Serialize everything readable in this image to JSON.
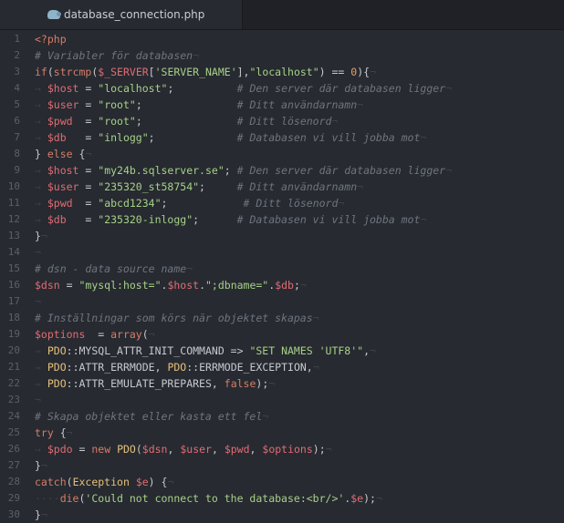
{
  "tab": {
    "filename": "database_connection.php",
    "icon": "php-elephant-icon"
  },
  "colors": {
    "background": "#272a30",
    "keyword": "#e5c07b",
    "variable": "#e06c75",
    "string": "#a6d189",
    "comment": "#6e7580",
    "number": "#e5a06b"
  },
  "lines": [
    {
      "n": "1",
      "tokens": [
        [
          "t-kw2",
          "<?php"
        ]
      ]
    },
    {
      "n": "2",
      "tokens": [
        [
          "t-cmt",
          "# Variabler för databasen"
        ],
        [
          "t-ws",
          "¬"
        ]
      ]
    },
    {
      "n": "3",
      "tokens": [
        [
          "t-fn",
          "if"
        ],
        [
          "t-pun",
          "("
        ],
        [
          "t-fn",
          "strcmp"
        ],
        [
          "t-pun",
          "("
        ],
        [
          "t-var",
          "$_SERVER"
        ],
        [
          "t-pun",
          "["
        ],
        [
          "t-str",
          "'SERVER_NAME'"
        ],
        [
          "t-pun",
          "],"
        ],
        [
          "t-str",
          "\"localhost\""
        ],
        [
          "t-pun",
          ") == "
        ],
        [
          "t-num",
          "0"
        ],
        [
          "t-pun",
          "){"
        ],
        [
          "t-ws",
          "¬"
        ]
      ]
    },
    {
      "n": "4",
      "tokens": [
        [
          "t-ws",
          "→ "
        ],
        [
          "t-var",
          "$host"
        ],
        [
          "t-op",
          " = "
        ],
        [
          "t-str",
          "\"localhost\""
        ],
        [
          "t-pun",
          ";          "
        ],
        [
          "t-cmt",
          "# Den server där databasen ligger"
        ],
        [
          "t-ws",
          "¬"
        ]
      ]
    },
    {
      "n": "5",
      "tokens": [
        [
          "t-ws",
          "→ "
        ],
        [
          "t-var",
          "$user"
        ],
        [
          "t-op",
          " = "
        ],
        [
          "t-str",
          "\"root\""
        ],
        [
          "t-pun",
          ";               "
        ],
        [
          "t-cmt",
          "# Ditt användarnamn"
        ],
        [
          "t-ws",
          "¬"
        ]
      ]
    },
    {
      "n": "6",
      "tokens": [
        [
          "t-ws",
          "→ "
        ],
        [
          "t-var",
          "$pwd"
        ],
        [
          "t-op",
          "  = "
        ],
        [
          "t-str",
          "\"root\""
        ],
        [
          "t-pun",
          ";               "
        ],
        [
          "t-cmt",
          "# Ditt lösenord"
        ],
        [
          "t-ws",
          "¬"
        ]
      ]
    },
    {
      "n": "7",
      "tokens": [
        [
          "t-ws",
          "→ "
        ],
        [
          "t-var",
          "$db"
        ],
        [
          "t-op",
          "   = "
        ],
        [
          "t-str",
          "\"inlogg\""
        ],
        [
          "t-pun",
          ";             "
        ],
        [
          "t-cmt",
          "# Databasen vi vill jobba mot"
        ],
        [
          "t-ws",
          "¬"
        ]
      ]
    },
    {
      "n": "8",
      "tokens": [
        [
          "t-pun",
          "} "
        ],
        [
          "t-fn",
          "else"
        ],
        [
          "t-pun",
          " {"
        ],
        [
          "t-ws",
          "¬"
        ]
      ]
    },
    {
      "n": "9",
      "tokens": [
        [
          "t-ws",
          "→ "
        ],
        [
          "t-var",
          "$host"
        ],
        [
          "t-op",
          " = "
        ],
        [
          "t-str",
          "\"my24b.sqlserver.se\""
        ],
        [
          "t-pun",
          "; "
        ],
        [
          "t-cmt",
          "# Den server där databasen ligger"
        ],
        [
          "t-ws",
          "¬"
        ]
      ]
    },
    {
      "n": "10",
      "tokens": [
        [
          "t-ws",
          "→ "
        ],
        [
          "t-var",
          "$user"
        ],
        [
          "t-op",
          " = "
        ],
        [
          "t-str",
          "\"235320_st58754\""
        ],
        [
          "t-pun",
          ";     "
        ],
        [
          "t-cmt",
          "# Ditt användarnamn"
        ],
        [
          "t-ws",
          "¬"
        ]
      ]
    },
    {
      "n": "11",
      "tokens": [
        [
          "t-ws",
          "→ "
        ],
        [
          "t-var",
          "$pwd"
        ],
        [
          "t-op",
          "  = "
        ],
        [
          "t-str",
          "\"abcd1234\""
        ],
        [
          "t-pun",
          ";            "
        ],
        [
          "t-cmt",
          "# Ditt lösenord"
        ],
        [
          "t-ws",
          "¬"
        ]
      ]
    },
    {
      "n": "12",
      "tokens": [
        [
          "t-ws",
          "→ "
        ],
        [
          "t-var",
          "$db"
        ],
        [
          "t-op",
          "   = "
        ],
        [
          "t-str",
          "\"235320-inlogg\""
        ],
        [
          "t-pun",
          ";      "
        ],
        [
          "t-cmt",
          "# Databasen vi vill jobba mot"
        ],
        [
          "t-ws",
          "¬"
        ]
      ]
    },
    {
      "n": "13",
      "tokens": [
        [
          "t-pun",
          "}"
        ],
        [
          "t-ws",
          "¬"
        ]
      ]
    },
    {
      "n": "14",
      "tokens": [
        [
          "t-ws",
          "¬"
        ]
      ]
    },
    {
      "n": "15",
      "tokens": [
        [
          "t-cmt",
          "# dsn - data source name"
        ],
        [
          "t-ws",
          "¬"
        ]
      ]
    },
    {
      "n": "16",
      "tokens": [
        [
          "t-var",
          "$dsn"
        ],
        [
          "t-op",
          " = "
        ],
        [
          "t-str",
          "\"mysql:host=\""
        ],
        [
          "t-pun",
          "."
        ],
        [
          "t-var",
          "$host"
        ],
        [
          "t-pun",
          "."
        ],
        [
          "t-str",
          "\";dbname=\""
        ],
        [
          "t-pun",
          "."
        ],
        [
          "t-var",
          "$db"
        ],
        [
          "t-pun",
          ";"
        ],
        [
          "t-ws",
          "¬"
        ]
      ]
    },
    {
      "n": "17",
      "tokens": [
        [
          "t-ws",
          "¬"
        ]
      ]
    },
    {
      "n": "18",
      "tokens": [
        [
          "t-cmt",
          "# Inställningar som körs när objektet skapas"
        ],
        [
          "t-ws",
          "¬"
        ]
      ]
    },
    {
      "n": "19",
      "tokens": [
        [
          "t-var",
          "$options"
        ],
        [
          "t-op",
          "  = "
        ],
        [
          "t-fn",
          "array"
        ],
        [
          "t-pun",
          "("
        ],
        [
          "t-ws",
          "¬"
        ]
      ]
    },
    {
      "n": "20",
      "tokens": [
        [
          "t-ws",
          "→ "
        ],
        [
          "t-cls",
          "PDO"
        ],
        [
          "t-pun",
          "::"
        ],
        [
          "t-const",
          "MYSQL_ATTR_INIT_COMMAND"
        ],
        [
          "t-op",
          " => "
        ],
        [
          "t-str",
          "\"SET NAMES 'UTF8'\""
        ],
        [
          "t-pun",
          ","
        ],
        [
          "t-ws",
          "¬"
        ]
      ]
    },
    {
      "n": "21",
      "tokens": [
        [
          "t-ws",
          "→ "
        ],
        [
          "t-cls",
          "PDO"
        ],
        [
          "t-pun",
          "::"
        ],
        [
          "t-const",
          "ATTR_ERRMODE"
        ],
        [
          "t-pun",
          ", "
        ],
        [
          "t-cls",
          "PDO"
        ],
        [
          "t-pun",
          "::"
        ],
        [
          "t-const",
          "ERRMODE_EXCEPTION"
        ],
        [
          "t-pun",
          ","
        ],
        [
          "t-ws",
          "¬"
        ]
      ]
    },
    {
      "n": "22",
      "tokens": [
        [
          "t-ws",
          "→ "
        ],
        [
          "t-cls",
          "PDO"
        ],
        [
          "t-pun",
          "::"
        ],
        [
          "t-const",
          "ATTR_EMULATE_PREPARES"
        ],
        [
          "t-pun",
          ", "
        ],
        [
          "t-fn",
          "false"
        ],
        [
          "t-pun",
          ");"
        ],
        [
          "t-ws",
          "¬"
        ]
      ]
    },
    {
      "n": "23",
      "tokens": [
        [
          "t-ws",
          "¬"
        ]
      ]
    },
    {
      "n": "24",
      "tokens": [
        [
          "t-cmt",
          "# Skapa objektet eller kasta ett fel"
        ],
        [
          "t-ws",
          "¬"
        ]
      ]
    },
    {
      "n": "25",
      "tokens": [
        [
          "t-fn",
          "try"
        ],
        [
          "t-pun",
          " {"
        ],
        [
          "t-ws",
          "¬"
        ]
      ]
    },
    {
      "n": "26",
      "tokens": [
        [
          "t-ws",
          "→ "
        ],
        [
          "t-var",
          "$pdo"
        ],
        [
          "t-op",
          " = "
        ],
        [
          "t-fn",
          "new"
        ],
        [
          "t-pun",
          " "
        ],
        [
          "t-cls",
          "PDO"
        ],
        [
          "t-pun",
          "("
        ],
        [
          "t-var",
          "$dsn"
        ],
        [
          "t-pun",
          ", "
        ],
        [
          "t-var",
          "$user"
        ],
        [
          "t-pun",
          ", "
        ],
        [
          "t-var",
          "$pwd"
        ],
        [
          "t-pun",
          ", "
        ],
        [
          "t-var",
          "$options"
        ],
        [
          "t-pun",
          ");"
        ],
        [
          "t-ws",
          "¬"
        ]
      ]
    },
    {
      "n": "27",
      "tokens": [
        [
          "t-pun",
          "}"
        ],
        [
          "t-ws",
          "¬"
        ]
      ]
    },
    {
      "n": "28",
      "tokens": [
        [
          "t-fn",
          "catch"
        ],
        [
          "t-pun",
          "("
        ],
        [
          "t-cls",
          "Exception"
        ],
        [
          "t-pun",
          " "
        ],
        [
          "t-var",
          "$e"
        ],
        [
          "t-pun",
          ") {"
        ],
        [
          "t-ws",
          "¬"
        ]
      ]
    },
    {
      "n": "29",
      "tokens": [
        [
          "t-ws",
          "····"
        ],
        [
          "t-fn",
          "die"
        ],
        [
          "t-pun",
          "("
        ],
        [
          "t-str",
          "'Could not connect to the database:<br/>'"
        ],
        [
          "t-pun",
          "."
        ],
        [
          "t-var",
          "$e"
        ],
        [
          "t-pun",
          ");"
        ],
        [
          "t-ws",
          "¬"
        ]
      ]
    },
    {
      "n": "30",
      "tokens": [
        [
          "t-pun",
          "}"
        ],
        [
          "t-ws",
          "¬"
        ]
      ]
    }
  ]
}
